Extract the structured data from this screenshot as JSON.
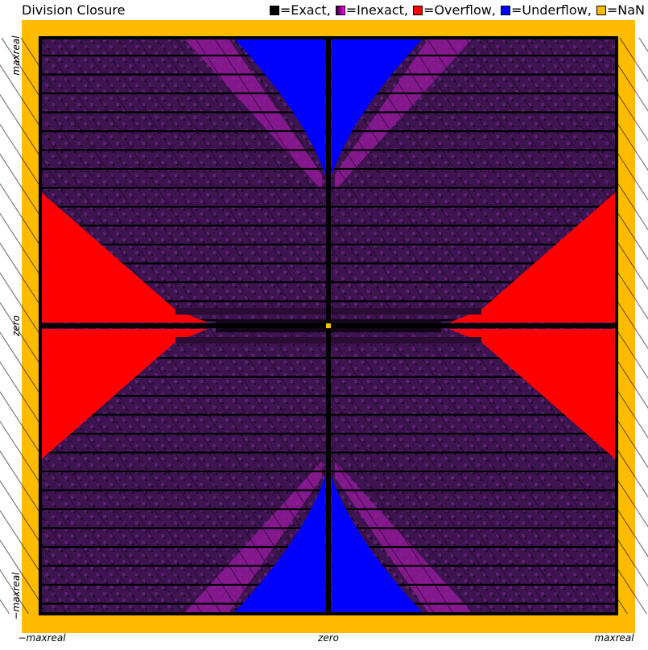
{
  "chart_data": {
    "type": "heatmap",
    "title": "Division Closure",
    "legend": [
      {
        "label": "=Exact",
        "color": "#000000",
        "sep": ","
      },
      {
        "label": "=Inexact",
        "color": "#aa00aa",
        "gradient": [
          "#330033",
          "#ff00ff"
        ],
        "sep": ","
      },
      {
        "label": "=Overflow",
        "color": "#ff0000",
        "sep": ","
      },
      {
        "label": "=Underflow",
        "color": "#0000ff",
        "sep": ","
      },
      {
        "label": "=NaN",
        "color": "#ffbb00",
        "sep": ""
      }
    ],
    "x_ticks": [
      "−maxreal",
      "zero",
      "maxreal"
    ],
    "y_ticks": [
      "−maxreal",
      "zero",
      "maxreal"
    ],
    "colors": {
      "frame": "#ffbb00",
      "exact": "#000000",
      "inexact_dark": "#3a1148",
      "inexact_light": "#a020a0",
      "overflow": "#ff0000",
      "underflow": "#0000ff",
      "nan": "#ffbb00"
    },
    "grid": true
  }
}
